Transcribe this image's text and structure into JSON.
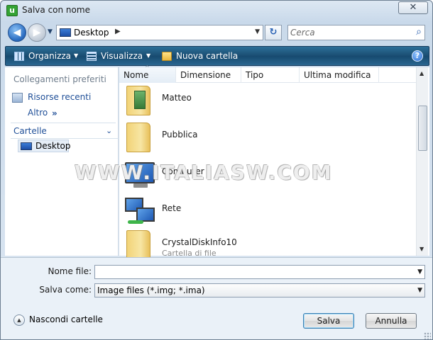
{
  "window": {
    "title": "Salva con nome",
    "app_icon_glyph": "u",
    "close_glyph": "✕"
  },
  "nav": {
    "back_glyph": "◀",
    "forward_glyph": "▶",
    "address": {
      "location": "Desktop",
      "arrow": "▶",
      "drop": "▼"
    },
    "refresh_glyph": "↻",
    "search": {
      "placeholder": "Cerca",
      "icon": "⌕"
    }
  },
  "toolbar": {
    "organize": "Organizza",
    "views": "Visualizza",
    "new_folder": "Nuova cartella",
    "arrow": "▼",
    "help_glyph": "?"
  },
  "sidebar": {
    "favorites_heading": "Collegamenti preferiti",
    "recent": "Risorse recenti",
    "more": "Altro",
    "more_arrow": "»",
    "folders_heading": "Cartelle",
    "folders_chevron": "⌄",
    "tree_selected": "Desktop"
  },
  "filelist": {
    "columns": [
      "Nome",
      "Dimensione",
      "Tipo",
      "Ultima modifica"
    ],
    "sort_arrow": "^",
    "items": [
      {
        "name": "Matteo",
        "icon": "user-folder-icon"
      },
      {
        "name": "Pubblica",
        "icon": "folder-icon"
      },
      {
        "name": "Computer",
        "icon": "computer-icon"
      },
      {
        "name": "Rete",
        "icon": "network-icon"
      },
      {
        "name": "CrystalDiskInfo10",
        "subtitle": "Cartella di file",
        "icon": "folder-icon"
      }
    ],
    "scroll_up": "▲",
    "scroll_down": "▼"
  },
  "watermark": "WWW.ITALIASW.COM",
  "form": {
    "filename_label": "Nome file:",
    "filename_value": "",
    "savetype_label": "Salva come:",
    "savetype_value": "Image files (*.img; *.ima)",
    "drop": "▼",
    "hide_folders": "Nascondi cartelle",
    "hide_glyph": "▲",
    "save_button": "Salva",
    "cancel_button": "Annulla"
  },
  "colors": {
    "toolbar": "#1a4d72",
    "link": "#1e4e97",
    "chrome": "#dce7f2"
  }
}
